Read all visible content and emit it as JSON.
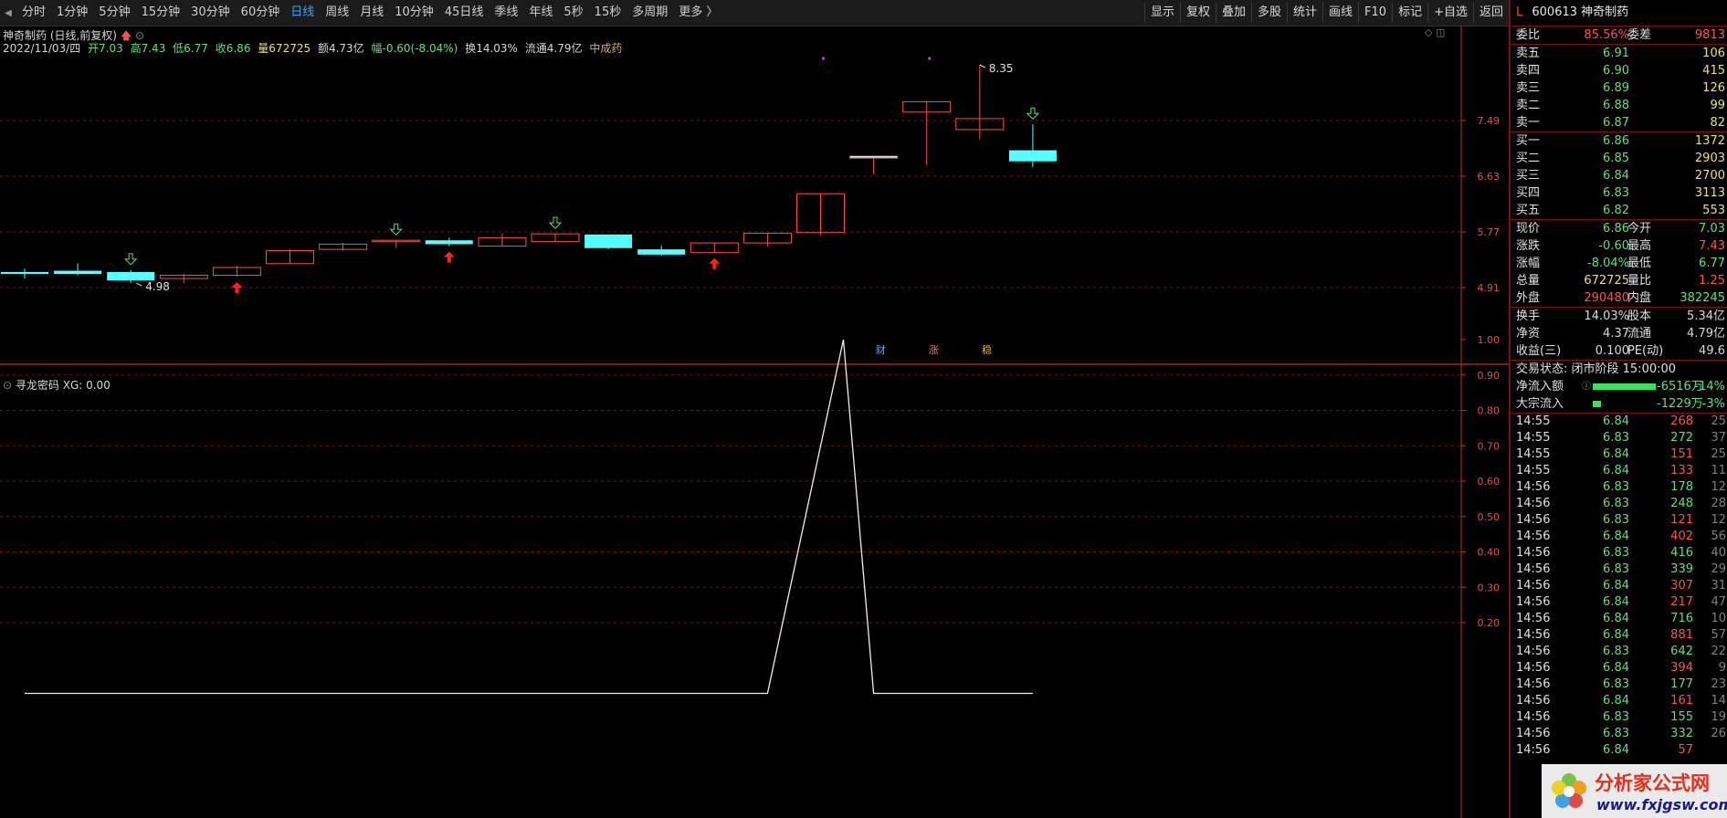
{
  "toolbar": {
    "collapse_glyph": "◀",
    "periods": [
      "分时",
      "1分钟",
      "5分钟",
      "15分钟",
      "30分钟",
      "60分钟",
      "日线",
      "周线",
      "月线",
      "10分钟",
      "45日线",
      "季线",
      "年线",
      "5秒",
      "15秒",
      "多周期",
      "更多 〉"
    ],
    "active_period": "日线",
    "buttons": [
      "显示",
      "复权",
      "叠加",
      "多股",
      "统计",
      "画线",
      "F10",
      "标记",
      "+自选",
      "返回"
    ]
  },
  "chart": {
    "title": "神奇制药 (日线,前复权)",
    "info": {
      "date": "2022/11/03/四",
      "open": "开7.03",
      "high": "高7.43",
      "low": "低6.77",
      "close": "收6.86",
      "volume": "量672725",
      "amount": "额4.73亿",
      "change": "幅-0.60(-8.04%)",
      "turnover": "换14.03%",
      "float": "流通4.79亿",
      "sector": "中成药"
    },
    "price_labels": [
      "7.49",
      "6.63",
      "5.77",
      "4.91"
    ],
    "high_label": "8.35",
    "low_label": "4.98",
    "event_markers": [
      "财",
      "涨",
      "稳"
    ],
    "colors": {
      "up": "#ff4a4a",
      "down": "#54ffff",
      "grid": "#7a1010",
      "axis": "#c03030"
    }
  },
  "indicator": {
    "title": "寻龙密码",
    "value": "XG: 0.00",
    "axis_labels": [
      "1.00",
      "0.90",
      "0.80",
      "0.70",
      "0.60",
      "0.50",
      "0.40",
      "0.30",
      "0.20"
    ]
  },
  "chart_data": {
    "type": "candlestick",
    "price_axis_ticks": [
      7.49,
      6.63,
      5.77,
      4.91
    ],
    "candles": [
      {
        "open": 5.15,
        "high": 5.2,
        "low": 5.05,
        "close": 5.12
      },
      {
        "open": 5.17,
        "high": 5.28,
        "low": 5.1,
        "close": 5.12
      },
      {
        "open": 5.15,
        "high": 5.18,
        "low": 4.98,
        "close": 5.02
      },
      {
        "open": 5.05,
        "high": 5.12,
        "low": 4.98,
        "close": 5.1
      },
      {
        "open": 5.1,
        "high": 5.25,
        "low": 5.08,
        "close": 5.22
      },
      {
        "open": 5.28,
        "high": 5.5,
        "low": 5.28,
        "close": 5.48
      },
      {
        "open": 5.5,
        "high": 5.6,
        "low": 5.48,
        "close": 5.58
      },
      {
        "open": 5.64,
        "high": 5.64,
        "low": 5.52,
        "close": 5.64
      },
      {
        "open": 5.64,
        "high": 5.68,
        "low": 5.55,
        "close": 5.58
      },
      {
        "open": 5.55,
        "high": 5.75,
        "low": 5.55,
        "close": 5.68
      },
      {
        "open": 5.62,
        "high": 5.74,
        "low": 5.62,
        "close": 5.74
      },
      {
        "open": 5.73,
        "high": 5.73,
        "low": 5.5,
        "close": 5.52
      },
      {
        "open": 5.5,
        "high": 5.56,
        "low": 5.4,
        "close": 5.42
      },
      {
        "open": 5.45,
        "high": 5.6,
        "low": 5.45,
        "close": 5.6
      },
      {
        "open": 5.6,
        "high": 5.75,
        "low": 5.55,
        "close": 5.75
      },
      {
        "open": 5.76,
        "high": 6.36,
        "low": 5.72,
        "close": 6.36
      },
      {
        "open": 6.93,
        "high": 6.93,
        "low": 6.66,
        "close": 6.93
      },
      {
        "open": 7.62,
        "high": 7.78,
        "low": 6.8,
        "close": 7.78
      },
      {
        "open": 7.35,
        "high": 8.35,
        "low": 7.2,
        "close": 7.52
      },
      {
        "open": 7.03,
        "high": 7.43,
        "low": 6.77,
        "close": 6.86
      }
    ],
    "up_arrows_at": [
      4,
      8,
      13
    ],
    "down_arrows_at": [
      2,
      7,
      10,
      19
    ],
    "indicator_axis_ticks": [
      1.0,
      0.9,
      0.8,
      0.7,
      0.6,
      0.5,
      0.4,
      0.3,
      0.2
    ],
    "indicator_series": [
      0,
      0,
      0,
      0,
      0,
      0,
      0,
      0,
      0,
      0,
      0,
      0,
      0,
      0,
      0,
      1,
      0,
      0,
      0,
      0
    ]
  },
  "quote": {
    "code": "600613",
    "name": "神奇制药",
    "weibi_label": "委比",
    "weibi": "85.56%",
    "weicha_label": "委差",
    "weicha": "9813",
    "sell": [
      {
        "label": "卖五",
        "price": "6.91",
        "vol": "106"
      },
      {
        "label": "卖四",
        "price": "6.90",
        "vol": "415"
      },
      {
        "label": "卖三",
        "price": "6.89",
        "vol": "126"
      },
      {
        "label": "卖二",
        "price": "6.88",
        "vol": "99"
      },
      {
        "label": "卖一",
        "price": "6.87",
        "vol": "82"
      }
    ],
    "buy": [
      {
        "label": "买一",
        "price": "6.86",
        "vol": "1372"
      },
      {
        "label": "买二",
        "price": "6.85",
        "vol": "2903"
      },
      {
        "label": "买三",
        "price": "6.84",
        "vol": "2700"
      },
      {
        "label": "买四",
        "price": "6.83",
        "vol": "3113"
      },
      {
        "label": "买五",
        "price": "6.82",
        "vol": "553"
      }
    ],
    "stats": [
      [
        "现价",
        "6.86",
        "今开",
        "7.03"
      ],
      [
        "涨跌",
        "-0.60",
        "最高",
        "7.43"
      ],
      [
        "涨幅",
        "-8.04%",
        "最低",
        "6.77"
      ],
      [
        "总量",
        "672725",
        "量比",
        "1.25"
      ],
      [
        "外盘",
        "290480",
        "内盘",
        "382245"
      ]
    ],
    "stats2": [
      [
        "换手",
        "14.03%",
        "股本",
        "5.34亿"
      ],
      [
        "净资",
        "4.37",
        "流通",
        "4.79亿"
      ],
      [
        "收益(三)",
        "0.100",
        "PE(动)",
        "49.6"
      ]
    ],
    "trade_state": "交易状态: 闭市阶段 15:00:00",
    "net_inflow_label": "净流入额",
    "net_inflow": "-6516万",
    "net_inflow_pct": "-14%",
    "net_inflow_level": 0.8,
    "block_inflow_label": "大宗流入",
    "block_inflow": "-1229万",
    "block_inflow_pct": "-3%",
    "block_inflow_level": 0.1,
    "ticks": [
      [
        "14:55",
        "6.84",
        "268",
        "25",
        "r"
      ],
      [
        "14:55",
        "6.83",
        "272",
        "37",
        "g"
      ],
      [
        "14:55",
        "6.84",
        "151",
        "25",
        "r"
      ],
      [
        "14:55",
        "6.84",
        "133",
        "11",
        "r"
      ],
      [
        "14:56",
        "6.83",
        "178",
        "12",
        "g"
      ],
      [
        "14:56",
        "6.83",
        "248",
        "28",
        "g"
      ],
      [
        "14:56",
        "6.83",
        "121",
        "12",
        "r"
      ],
      [
        "14:56",
        "6.84",
        "402",
        "56",
        "r"
      ],
      [
        "14:56",
        "6.83",
        "416",
        "40",
        "g"
      ],
      [
        "14:56",
        "6.83",
        "339",
        "29",
        "g"
      ],
      [
        "14:56",
        "6.84",
        "307",
        "31",
        "r"
      ],
      [
        "14:56",
        "6.84",
        "217",
        "47",
        "r"
      ],
      [
        "14:56",
        "6.84",
        "716",
        "10",
        "g"
      ],
      [
        "14:56",
        "6.84",
        "881",
        "57",
        "r"
      ],
      [
        "14:56",
        "6.83",
        "642",
        "22",
        "g"
      ],
      [
        "14:56",
        "6.84",
        "394",
        "9",
        "r"
      ],
      [
        "14:56",
        "6.83",
        "177",
        "23",
        "g"
      ],
      [
        "14:56",
        "6.84",
        "161",
        "14",
        "r"
      ],
      [
        "14:56",
        "6.83",
        "155",
        "19",
        "g"
      ],
      [
        "14:56",
        "6.83",
        "332",
        "26",
        "g"
      ],
      [
        "14:56",
        "6.84",
        "57",
        "",
        "r"
      ]
    ]
  },
  "logo": {
    "text": "分析家公式网",
    "url": "www.fxjgsw.com"
  }
}
